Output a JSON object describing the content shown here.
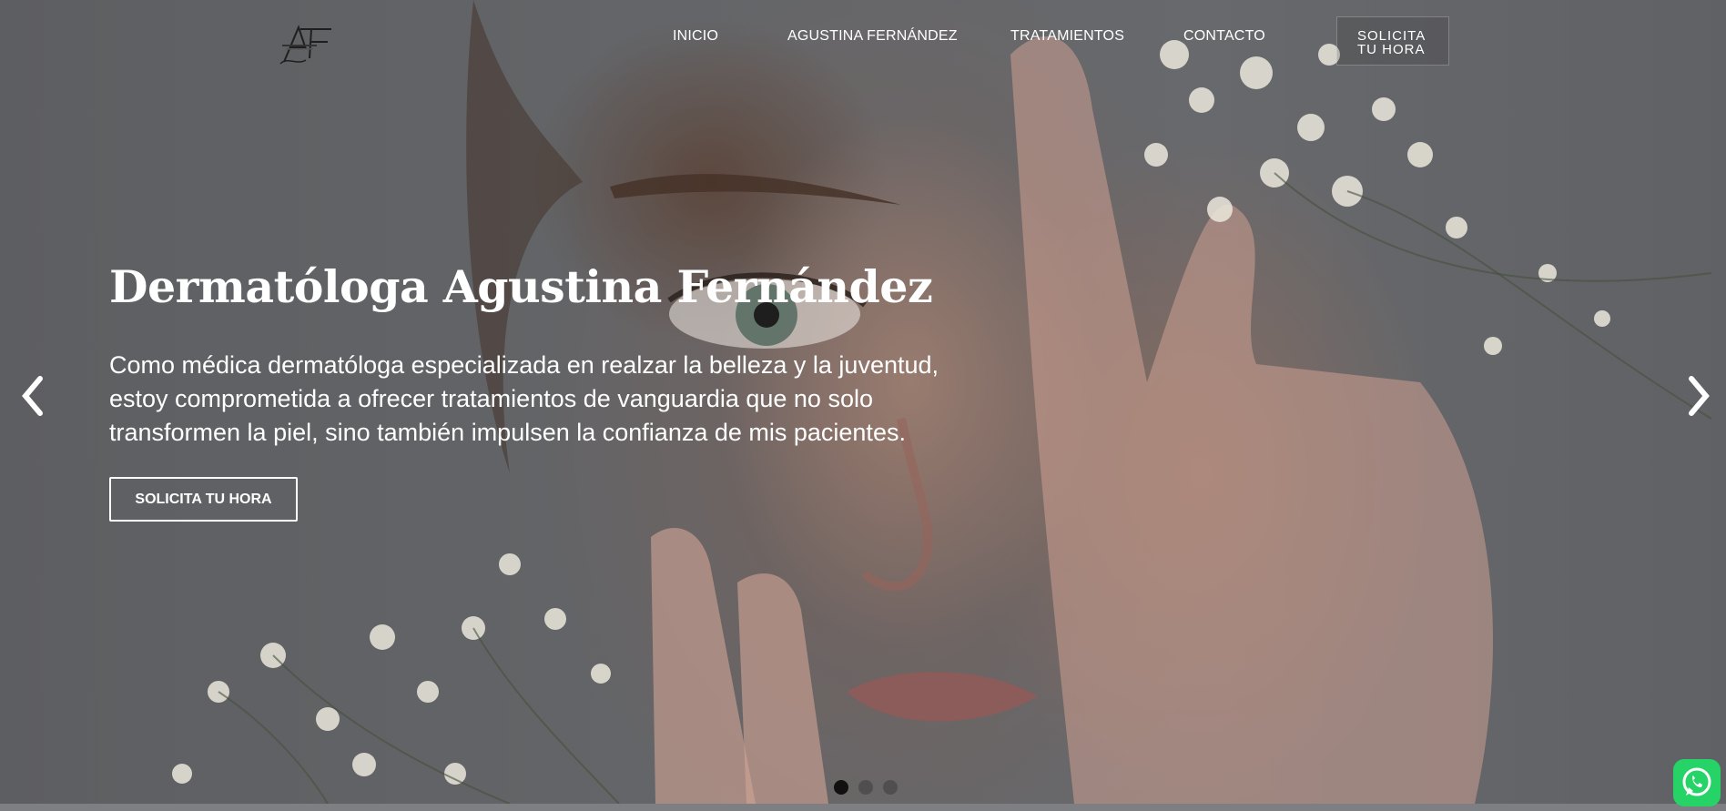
{
  "header": {
    "nav": [
      "INICIO",
      "AGUSTINA FERNÁNDEZ",
      "TRATAMIENTOS",
      "CONTACTO"
    ],
    "cta_line1": "SOLICITA",
    "cta_line2": "TU HORA"
  },
  "hero": {
    "title": "Dermatóloga Agustina Fernández",
    "description": "Como médica dermatóloga especializada en realzar la belleza y la juventud, estoy comprometida a ofrecer tratamientos de vanguardia que no solo transformen la piel, sino también impulsen la confianza de mis pacientes.",
    "button_label": "SOLICITA TU HORA"
  },
  "carousel": {
    "slide_count": 3,
    "active_index": 0,
    "prev_icon": "chevron-left-icon",
    "next_icon": "chevron-right-icon"
  },
  "floating": {
    "icon": "whatsapp-icon",
    "color": "#25d366"
  }
}
